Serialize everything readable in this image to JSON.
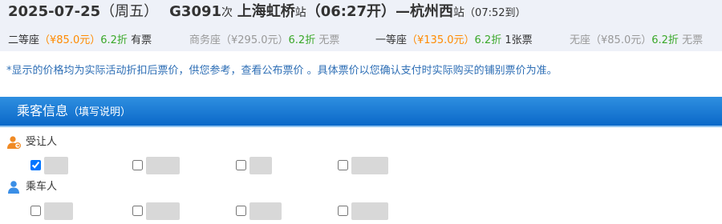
{
  "train": {
    "date": "2025-07-25",
    "weekday": "（周五）",
    "number": "G3091",
    "number_suffix": "次",
    "from_station": "上海虹桥",
    "from_suffix": "站",
    "depart_time": "（06:27开）",
    "dash": "—",
    "to_station": "杭州西",
    "to_suffix": "站",
    "arrive_time": "（07:52到）"
  },
  "seats": [
    {
      "name": "二等座",
      "price": "（¥85.0元）",
      "discount": "6.2折",
      "availability": "有票",
      "sold_out": false
    },
    {
      "name": "商务座",
      "price": "（¥295.0元）",
      "discount": "6.2折",
      "availability": "无票",
      "sold_out": true
    },
    {
      "name": "一等座",
      "price": "（¥135.0元）",
      "discount": "6.2折",
      "availability": "1张票",
      "sold_out": false
    },
    {
      "name": "无座",
      "price": "（¥85.0元）",
      "discount": "6.2折",
      "availability": "无票",
      "sold_out": true
    }
  ],
  "notice": {
    "text_before": "*显示的价格均为实际活动折扣后票价，供您参考，",
    "link": "查看公布票价",
    "text_after": " 。具体票价以您确认支付时实际购买的铺别票价为准。"
  },
  "section": {
    "title": "乘客信息",
    "subtitle": "（填写说明）"
  },
  "groups": {
    "beneficiary_label": "受让人",
    "passenger_label": "乘车人"
  },
  "passengers": {
    "beneficiaries": [
      {
        "checked": true
      },
      {
        "checked": false
      },
      {
        "checked": false
      },
      {
        "checked": false
      }
    ],
    "riders": [
      {
        "checked": false
      },
      {
        "checked": false
      },
      {
        "checked": false
      },
      {
        "checked": false
      }
    ]
  },
  "colors": {
    "price": "#ff8a00",
    "discount": "#3aa829",
    "notice": "#2d6eb5",
    "section_bar": "#1478d4",
    "icon_orange": "#f08a24",
    "icon_blue": "#3a8ee6"
  },
  "icons": {
    "beneficiary": "transfer-person-icon",
    "passenger": "person-icon"
  }
}
